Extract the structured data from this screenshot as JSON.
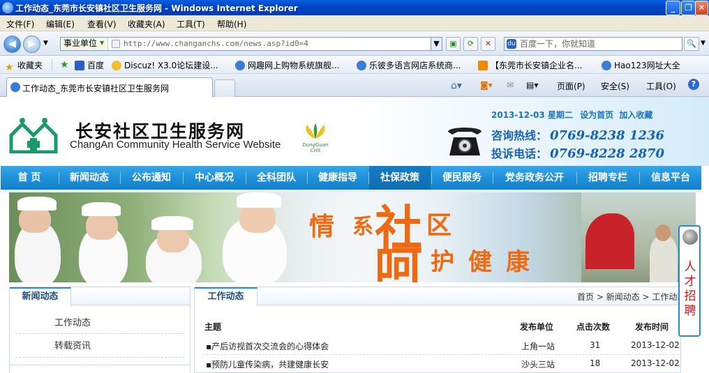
{
  "window": {
    "title": "工作动态_东莞市长安镇社区卫生服务网 - Windows Internet Explorer",
    "min_label": "_",
    "max_label": "❐",
    "close_label": "✕"
  },
  "menubar": [
    "文件(F)",
    "编辑(E)",
    "查看(V)",
    "收藏夹(A)",
    "工具(T)",
    "帮助(H)"
  ],
  "address": {
    "category": "事业单位",
    "url": "http://www.changanchs.com/news.asp?id0=4"
  },
  "search": {
    "placeholder": "百度一下，你就知道"
  },
  "favorites": {
    "label": "收藏夹",
    "items": [
      "百度",
      "Discuz! X3.0论坛建设...",
      "网趣网上购物系统旗舰...",
      "乐彼多语言网店系统商...",
      "【东莞市长安镇企业名...",
      "Hao123网址大全"
    ]
  },
  "tab": {
    "title": "工作动态_东莞市长安镇社区卫生服务网"
  },
  "commands": {
    "page": "页面(P)",
    "safety": "安全(S)",
    "tools": "工具(O)"
  },
  "site": {
    "name_cn": "长安社区卫生服务网",
    "name_en": "ChangAn Community Health Service Website",
    "dg_logo_text": "DongGuan CHS",
    "date_line": "2013-12-03 星期二",
    "set_home": "设为首页",
    "add_fav": "加入收藏",
    "hotline_label": "咨询热线：",
    "hotline": "0769-8238 1236",
    "complaint_label": "投诉电话：",
    "complaint": "0769-8228 2870"
  },
  "nav": [
    "首 页",
    "新闻动态",
    "公布通知",
    "中心概况",
    "全科团队",
    "健康指导",
    "社保政策",
    "便民服务",
    "党务政务公开",
    "招聘专栏",
    "信息平台"
  ],
  "banner": {
    "slogan": [
      "情",
      "系",
      "社",
      "区",
      "呵",
      "护",
      "健",
      "康"
    ]
  },
  "left_box": {
    "title": "新闻动态",
    "items": [
      "工作动态",
      "转载资讯"
    ]
  },
  "right_box": {
    "title": "工作动态",
    "breadcrumb": "首页 > 新闻动态 > 工作动态",
    "headers": {
      "subject": "主题",
      "unit": "发布单位",
      "clicks": "点击次数",
      "time": "发布时间"
    },
    "rows": [
      {
        "subject": "▪产后访视首次交流会的心得体会",
        "unit": "上角一站",
        "clicks": "31",
        "time": "2013-12-02"
      },
      {
        "subject": "▪预防儿童传染病，共建健康长安",
        "unit": "沙头三站",
        "clicks": "18",
        "time": "2013-12-02"
      }
    ]
  },
  "recruit": {
    "text": "人才招聘"
  },
  "colors": {
    "nav_blue": "#1d8fd8",
    "slogan_orange": "#ef6a10",
    "title_bar": "#0045c8",
    "recruit_red": "#d8141a"
  }
}
